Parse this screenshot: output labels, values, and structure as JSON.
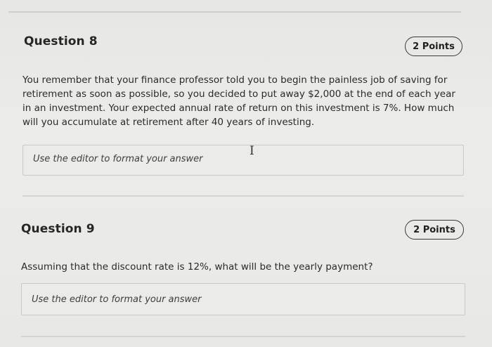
{
  "q8": {
    "title": "Question 8",
    "points": "2 Points",
    "body": "You remember that your finance professor told you to begin the painless job of saving for retirement as soon as possible, so you decided to put away $2,000 at the end of each year in an investment. Your expected annual rate of return on this investment is 7%. How much will you accumulate at retirement after 40 years of investing.",
    "answer_placeholder": "Use the editor to format your answer"
  },
  "q9": {
    "title": "Question 9",
    "points": "2 Points",
    "body": "Assuming that the discount rate is 12%, what will be the yearly payment?",
    "answer_placeholder": "Use the editor to format your answer"
  },
  "icons": {
    "text_cursor": "text-cursor-icon"
  }
}
